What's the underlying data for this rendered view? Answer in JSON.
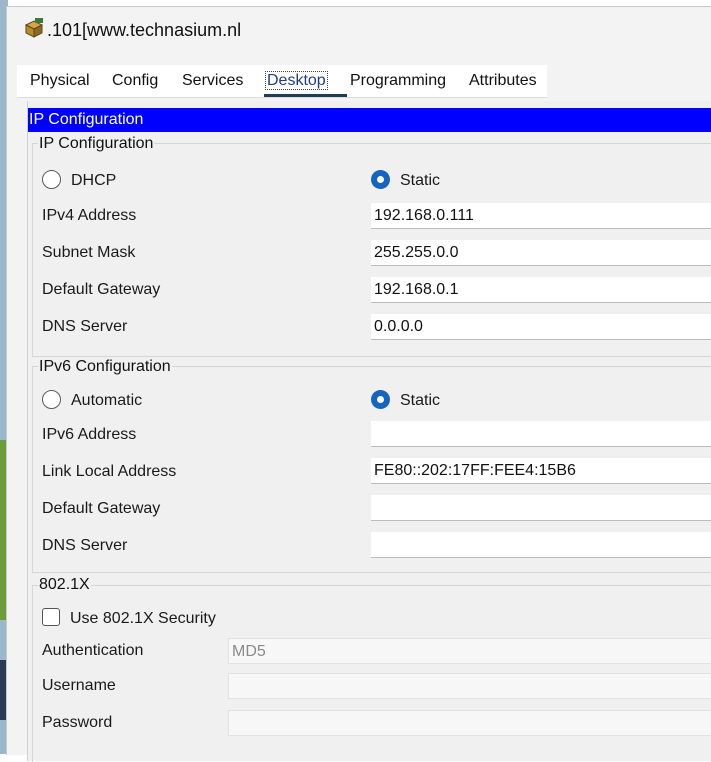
{
  "window": {
    "title": ".101[www.technasium.nl"
  },
  "tabs": [
    {
      "label": "Physical"
    },
    {
      "label": "Config"
    },
    {
      "label": "Services"
    },
    {
      "label": "Desktop",
      "active": true
    },
    {
      "label": "Programming"
    },
    {
      "label": "Attributes"
    }
  ],
  "panel": {
    "header": "IP Configuration"
  },
  "ipv4": {
    "section_title": "IP Configuration",
    "dhcp_label": "DHCP",
    "static_label": "Static",
    "selected_mode": "Static",
    "address_label": "IPv4 Address",
    "address_value": "192.168.0.111",
    "subnet_label": "Subnet Mask",
    "subnet_value": "255.255.0.0",
    "gateway_label": "Default Gateway",
    "gateway_value": "192.168.0.1",
    "dns_label": "DNS Server",
    "dns_value": "0.0.0.0"
  },
  "ipv6": {
    "section_title": "IPv6 Configuration",
    "auto_label": "Automatic",
    "static_label": "Static",
    "selected_mode": "Static",
    "address_label": "IPv6 Address",
    "address_value": "",
    "link_local_label": "Link Local Address",
    "link_local_value": "FE80::202:17FF:FEE4:15B6",
    "gateway_label": "Default Gateway",
    "gateway_value": "",
    "dns_label": "DNS Server",
    "dns_value": ""
  },
  "dot1x": {
    "section_title": "802.1X",
    "use_label": "Use 802.1X Security",
    "use_checked": false,
    "auth_label": "Authentication",
    "auth_value": "MD5",
    "username_label": "Username",
    "username_value": "",
    "password_label": "Password",
    "password_value": ""
  },
  "colors": {
    "header_bg": "#0000ff",
    "radio_selected": "#1565c0",
    "tab_underline": "#1f3c55"
  }
}
